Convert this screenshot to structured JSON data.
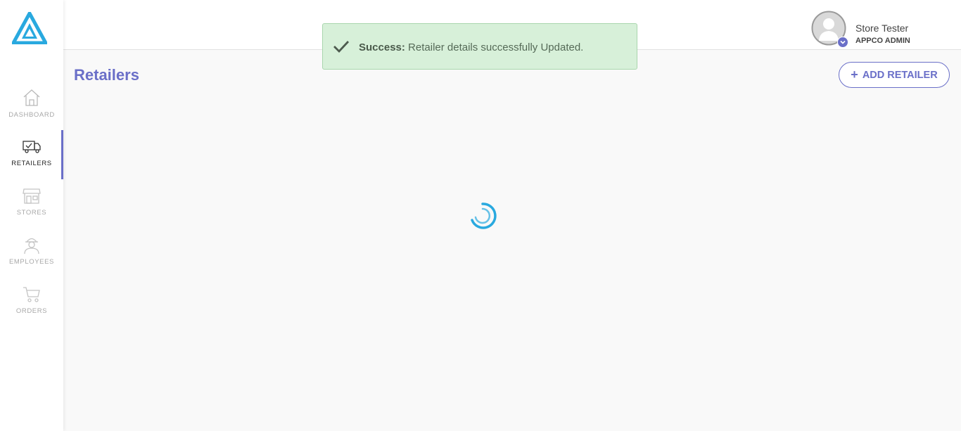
{
  "sidebar": {
    "logo_icon": "brand-logo-icon",
    "items": [
      {
        "label": "DASHBOARD",
        "icon": "home-icon",
        "active": false
      },
      {
        "label": "RETAILERS",
        "icon": "truck-icon",
        "active": true
      },
      {
        "label": "STORES",
        "icon": "store-icon",
        "active": false
      },
      {
        "label": "EMPLOYEES",
        "icon": "worker-icon",
        "active": false
      },
      {
        "label": "ORDERS",
        "icon": "cart-icon",
        "active": false
      }
    ]
  },
  "header": {
    "user": {
      "name": "Store Tester",
      "role": "APPCO ADMIN",
      "avatar_icon": "user-avatar-icon",
      "badge_icon": "chevron-down-icon"
    }
  },
  "toast": {
    "type": "success",
    "title": "Success:",
    "message": "Retailer details successfully Updated.",
    "icon": "check-icon"
  },
  "page": {
    "title": "Retailers",
    "add_button_label": "ADD RETAILER",
    "add_button_icon": "plus-icon",
    "loading": true
  },
  "colors": {
    "accent": "#6a6fc8",
    "logo": "#29a9df",
    "toast_bg": "#d7f0d9",
    "spinner": "#29a9df"
  }
}
